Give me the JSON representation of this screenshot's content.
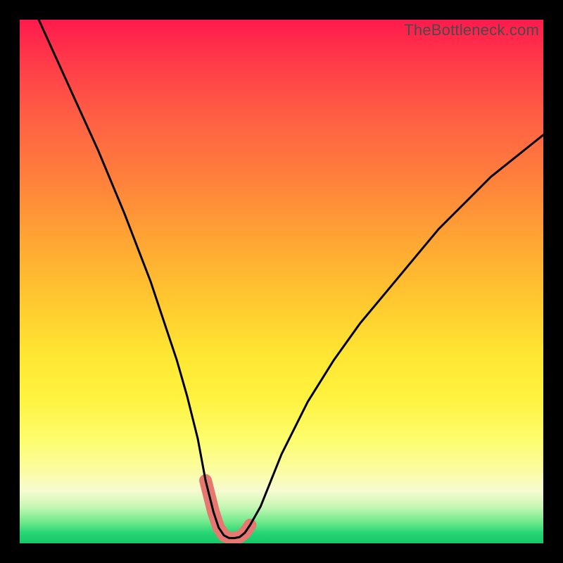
{
  "watermark": "TheBottleneck.com",
  "chart_data": {
    "type": "line",
    "title": "",
    "xlabel": "",
    "ylabel": "",
    "xlim": [
      0,
      100
    ],
    "ylim": [
      0,
      100
    ],
    "series": [
      {
        "name": "bottleneck-curve",
        "x": [
          0,
          5,
          10,
          15,
          20,
          25,
          28,
          30,
          32,
          34,
          35.5,
          37,
          38,
          39,
          40,
          41,
          42,
          43,
          44,
          46,
          48,
          50,
          55,
          60,
          65,
          70,
          75,
          80,
          85,
          90,
          95,
          100
        ],
        "values": [
          108,
          97,
          86,
          75,
          63,
          50,
          41,
          35,
          28,
          20,
          12,
          6,
          3,
          1.5,
          1,
          1,
          1.2,
          2,
          3.5,
          7,
          12,
          17,
          27,
          35,
          42,
          48,
          54,
          60,
          65,
          70,
          74,
          78
        ]
      },
      {
        "name": "highlight-band",
        "x": [
          35.5,
          37,
          38,
          39,
          40,
          41,
          42,
          43,
          44
        ],
        "values": [
          12,
          6,
          3,
          1.5,
          1,
          1,
          1.2,
          2,
          3.5
        ]
      }
    ],
    "gradient_stops": [
      {
        "pct": 0,
        "color": "#ff1a4d"
      },
      {
        "pct": 18,
        "color": "#ff5d44"
      },
      {
        "pct": 42,
        "color": "#ffa534"
      },
      {
        "pct": 64,
        "color": "#ffe633"
      },
      {
        "pct": 86,
        "color": "#fbfca0"
      },
      {
        "pct": 96,
        "color": "#6de98a"
      },
      {
        "pct": 100,
        "color": "#13c96a"
      }
    ],
    "highlight_color": "#e77871",
    "curve_color": "#000000"
  }
}
